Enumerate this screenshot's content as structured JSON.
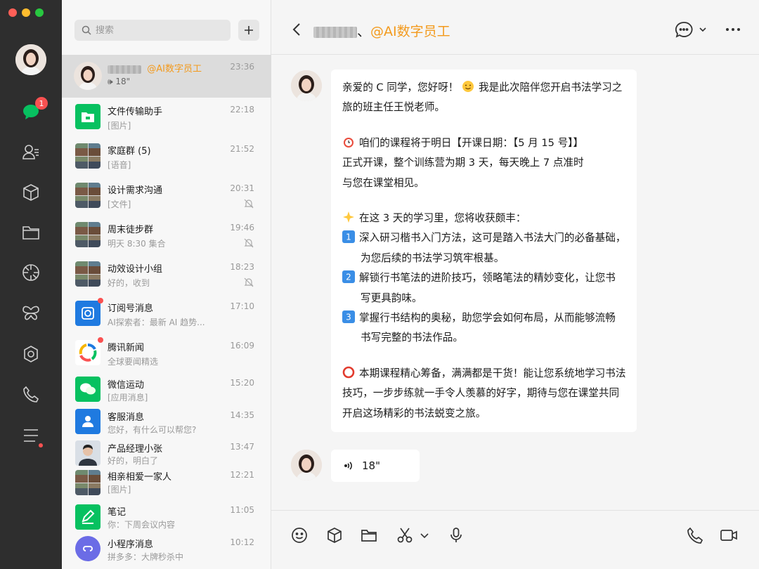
{
  "window": {
    "traffic_colors": [
      "#ff5f57",
      "#febc2e",
      "#28c840"
    ]
  },
  "rail": {
    "unread_badge": "1",
    "icons": [
      "chat-icon",
      "contacts-icon",
      "cube-icon",
      "folder-icon",
      "moments-icon",
      "butterfly-icon",
      "settings-icon",
      "phone-icon",
      "menu-icon"
    ]
  },
  "search": {
    "placeholder": "搜索"
  },
  "conversations": [
    {
      "name_suffix": "@AI数字员工",
      "preview": "18\"",
      "time": "23:36"
    },
    {
      "name": "文件传输助手",
      "preview": "[图片]",
      "time": "22:18"
    },
    {
      "name": "家庭群 (5)",
      "preview": "[语音]",
      "time": "21:52"
    },
    {
      "name": "设计需求沟通",
      "preview": "[文件]",
      "time": "20:31"
    },
    {
      "name": "周末徒步群",
      "preview": "明天 8:30 集合",
      "time": "19:46"
    },
    {
      "name": "动效设计小组",
      "preview": "好的，收到",
      "time": "18:23"
    },
    {
      "name": "订阅号消息",
      "preview": "AI探索者：最新 AI 趋势...",
      "time": "17:10"
    },
    {
      "name": "腾讯新闻",
      "preview": "全球要闻精选",
      "time": "16:09"
    },
    {
      "name": "微信运动",
      "preview": "[应用消息]",
      "time": "15:20"
    },
    {
      "name": "客服消息",
      "preview": "您好，有什么可以帮您?",
      "time": "14:35"
    },
    {
      "name": "产品经理小张",
      "preview": "好的，明白了",
      "time": "13:47"
    },
    {
      "name": "相亲相爱一家人",
      "preview": "[图片]",
      "time": "12:21"
    },
    {
      "name": "笔记",
      "preview": "你：下周会议内容",
      "time": "11:05"
    },
    {
      "name": "小程序消息",
      "preview": "拼多多：大牌秒杀中",
      "time": "10:12"
    }
  ],
  "chat": {
    "title_separator": "、",
    "title_highlight": "@AI数字员工",
    "message": {
      "l1": "亲爱的 C 同学，您好呀！",
      "l1b": "我是此次陪伴您开启书法学习之",
      "l2": "旅的班主任王悦老师。",
      "l3": "咱们的课程将于明日【开课日期：【5 月 15 号】】",
      "l4": "正式开课，整个训练营为期 3 天，每天晚上 7 点准时",
      "l5": "与您在课堂相见。",
      "l6": "在这 3 天的学习里，您将收获颇丰：",
      "l7": "深入研习楷书入门方法，这可是踏入书法大门的必备基础，",
      "l8": "为您后续的书法学习筑牢根基。",
      "l9": "解锁行书笔法的进阶技巧，领略笔法的精妙变化，让您书",
      "l10": "写更具韵味。",
      "l11": "掌握行书结构的奥秘，助您学会如何布局，从而能够流畅",
      "l12": "书写完整的书法作品。",
      "l13": "本期课程精心筹备，满满都是干货！能让您系统地学习书法",
      "l14": "技巧，一步步练就一手令人羡慕的好字，期待与您在课堂共同",
      "l15": "开启这场精彩的书法蜕变之旅。",
      "n1": "1",
      "n2": "2",
      "n3": "3"
    },
    "voice_duration": "18\""
  },
  "colors": {
    "accent": "#f39a1d",
    "badge": "#fa5151",
    "wechat_green": "#07c160"
  }
}
